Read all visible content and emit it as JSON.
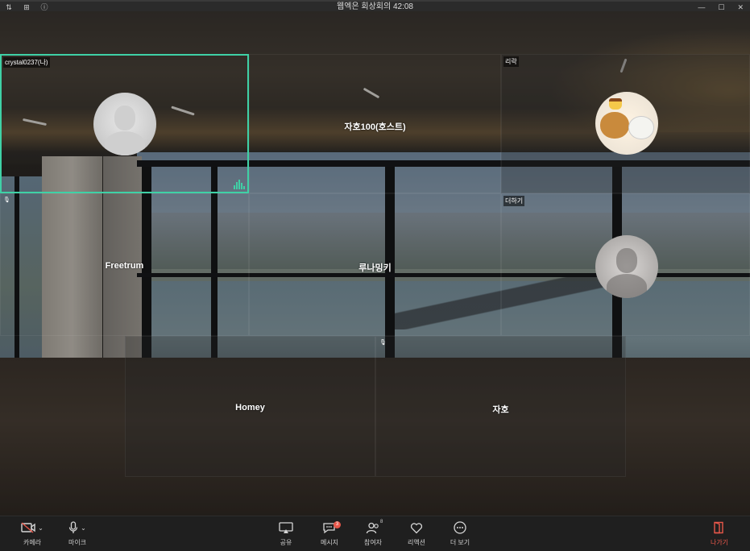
{
  "window": {
    "title": "웹엑은 회상회의 42:08",
    "left_icons": [
      "layout-switch-icon",
      "grid-icon",
      "info-icon"
    ],
    "controls": [
      "minimize-icon",
      "maximize-icon",
      "close-icon"
    ]
  },
  "participants": {
    "self": {
      "tag": "crystal0237(나)"
    },
    "host": {
      "name": "자호100(호스트)"
    },
    "rirak": {
      "tag": "리락"
    },
    "deohagi": {
      "tag": "더하기"
    },
    "freetrum": {
      "name": "Freetrum"
    },
    "runaming": {
      "name": "루나밍키"
    },
    "homey": {
      "name": "Homey"
    },
    "jaho": {
      "name": "자호"
    }
  },
  "toolbar": {
    "camera": "카메라",
    "mic": "마이크",
    "share": "공유",
    "messages": "메시지",
    "messages_badge": "3",
    "participants": "참여자",
    "participants_count": "8",
    "reactions": "리액션",
    "more": "더 보기",
    "leave": "나가기"
  },
  "colors": {
    "active_speaker": "#3fd1a6",
    "leave": "#e8574a",
    "toolbar_bg": "#1f1f1f"
  }
}
